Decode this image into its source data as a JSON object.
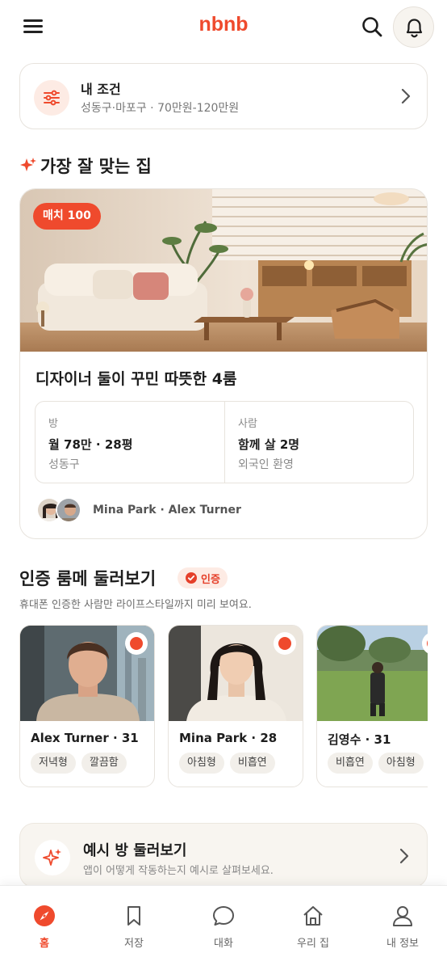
{
  "app": {
    "name": "nbnb"
  },
  "colors": {
    "accent": "#ef4a2d",
    "accent_soft": "#fdebe4",
    "text": "#1d1d1d",
    "muted": "#8a8a8a",
    "border": "#e7e3dd"
  },
  "header": {
    "menu_icon": "menu-icon",
    "search_icon": "search-icon",
    "bell_icon": "bell-icon"
  },
  "conditions": {
    "title": "내 조건",
    "summary": "성동구·마포구 · 70만원-120만원",
    "icon": "sliders-icon"
  },
  "best_match": {
    "section_title": "가장 잘 맞는 집",
    "icon": "sparkle-icon",
    "listing": {
      "match_badge": "매치 100",
      "title": "디자이너 둘이 꾸민 따뜻한 4룸",
      "room": {
        "label": "방",
        "value": "월 78만 · 28평",
        "location": "성동구"
      },
      "people": {
        "label": "사람",
        "value": "함께 살 2명",
        "note": "외국인 환영"
      },
      "owners": "Mina Park · Alex Turner"
    }
  },
  "verified": {
    "section_title": "인증 룸메 둘러보기",
    "badge": "인증",
    "subtitle": "휴대폰 인증한 사람만 라이프스타일까지 미리 보여요.",
    "mates": [
      {
        "name": "Alex Turner · 31",
        "tags": [
          "저녁형",
          "깔끔함"
        ]
      },
      {
        "name": "Mina Park · 28",
        "tags": [
          "아침형",
          "비흡연"
        ]
      },
      {
        "name": "김영수 · 31",
        "tags": [
          "비흡연",
          "아침형"
        ]
      }
    ]
  },
  "example": {
    "title": "예시 방 둘러보기",
    "subtitle": "앱이 어떻게 작동하는지 예시로 살펴보세요.",
    "icon": "sparkle-icon"
  },
  "tabs": [
    {
      "label": "홈",
      "icon": "compass-icon",
      "active": true
    },
    {
      "label": "저장",
      "icon": "bookmark-icon",
      "active": false
    },
    {
      "label": "대화",
      "icon": "chat-icon",
      "active": false
    },
    {
      "label": "우리 집",
      "icon": "house-icon",
      "active": false
    },
    {
      "label": "내 정보",
      "icon": "person-icon",
      "active": false
    }
  ]
}
